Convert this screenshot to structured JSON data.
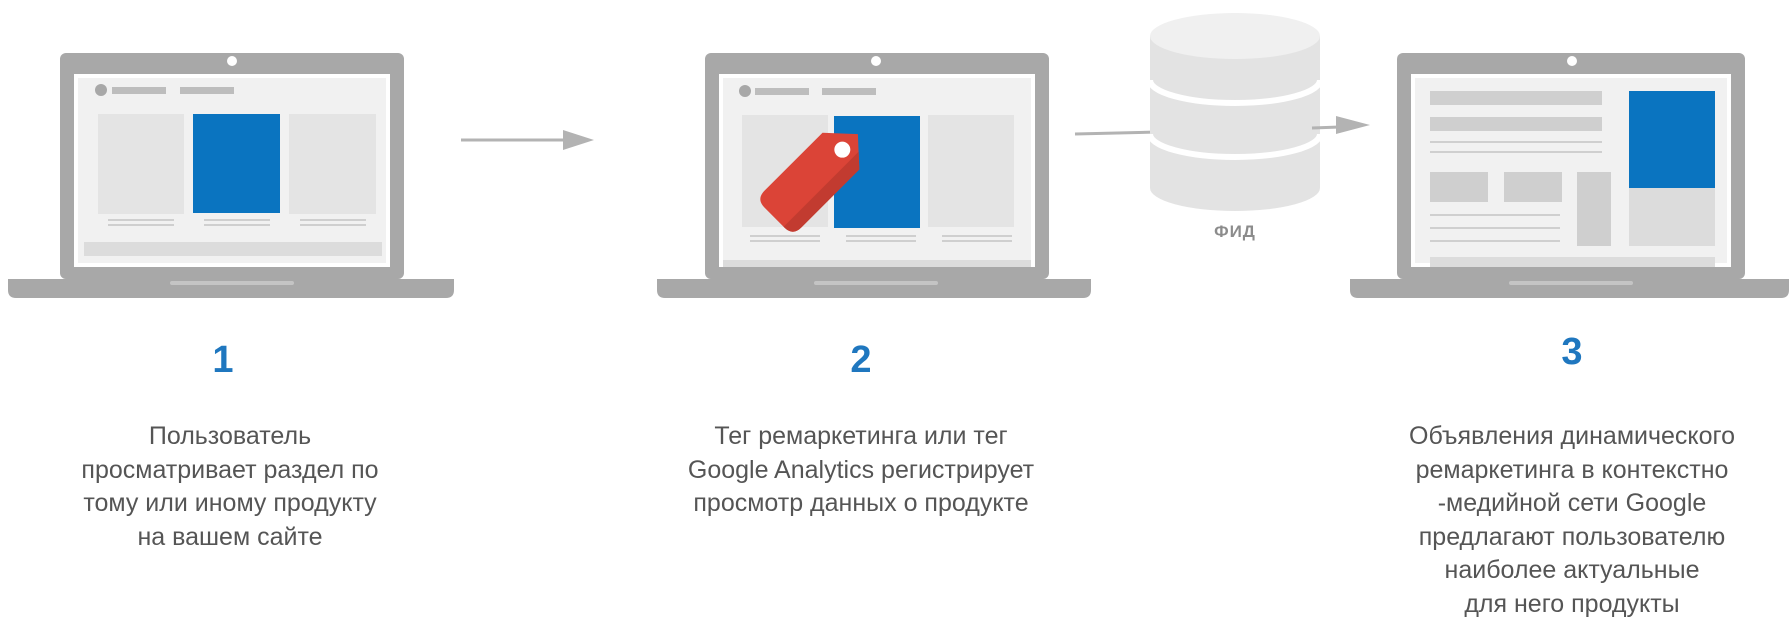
{
  "steps": [
    {
      "number": "1",
      "lines": [
        "Пользователь",
        "просматривает раздел по",
        "тому или иному продукту",
        "на вашем сайте"
      ]
    },
    {
      "number": "2",
      "lines": [
        "Тег ремаркетинга или тег",
        "Google Analytics регистрирует",
        "просмотр данных о продукте"
      ]
    },
    {
      "number": "3",
      "lines": [
        "Объявления динамического",
        "ремаркетинга в контекстно",
        "-медийной сети Google",
        "предлагают пользователю",
        "наиболее актуальные",
        "для него продукты"
      ]
    }
  ],
  "feed": {
    "label": "ФИД"
  },
  "colors": {
    "accent_blue": "#0a74c0",
    "tag_red": "#db4437",
    "number_blue": "#1f77bf",
    "laptop_gray": "#a8a8a8",
    "text_gray": "#555555"
  },
  "icons": [
    "laptop-icon",
    "price-tag-icon",
    "database-icon",
    "arrow-right-icon"
  ]
}
